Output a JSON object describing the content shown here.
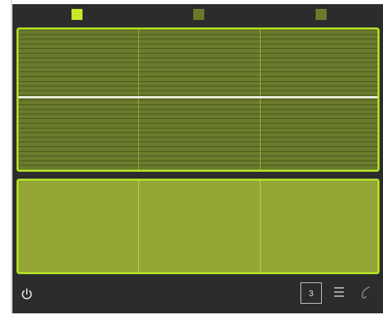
{
  "tabs": [
    {
      "id": "tab-1",
      "active": true
    },
    {
      "id": "tab-2",
      "active": false
    },
    {
      "id": "tab-3",
      "active": false
    }
  ],
  "colors": {
    "accent": "#b4df25",
    "tab_active": "#c9e829",
    "tab_inactive": "#6b7a2a",
    "sequencer_bg": "#6b7b2c",
    "pad_bg": "#95a637",
    "background": "#2c2c2c",
    "center_line": "#f1f1ea"
  },
  "toolbar": {
    "power_icon": "power-icon",
    "count_value": "3",
    "menu_icon": "menu-icon",
    "undo_icon": "undo-icon"
  }
}
